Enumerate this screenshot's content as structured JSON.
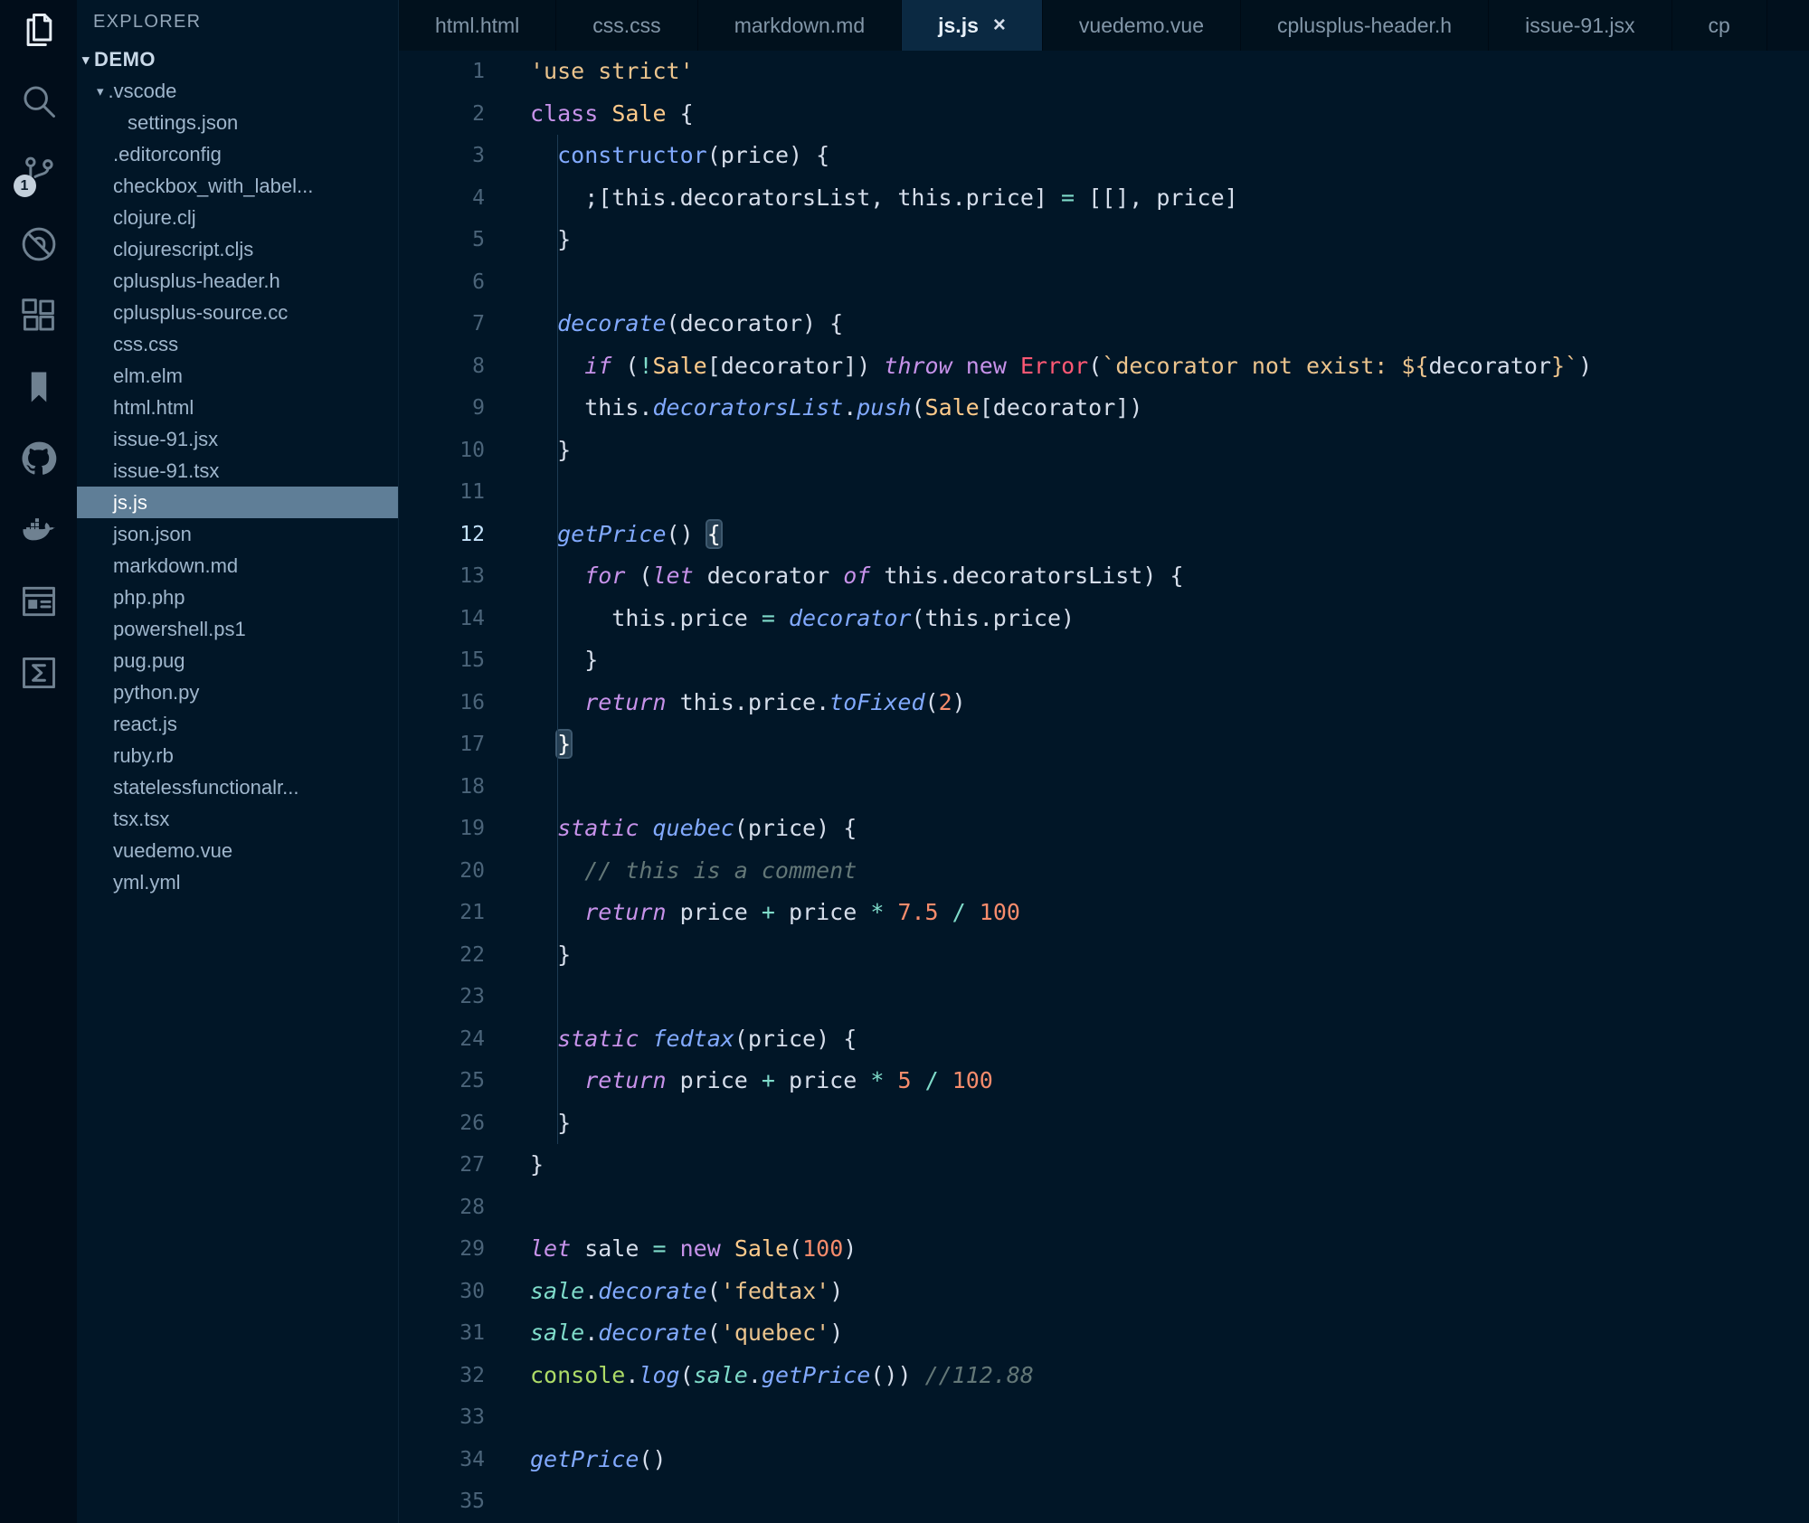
{
  "theme": {
    "bg": "#011627",
    "fg": "#d6deeb",
    "panel": "#010d1a",
    "tabbar": "#01101d",
    "tab_active_bg": "#0b2942",
    "kw": "#c792ea",
    "fn": "#82aaff",
    "str": "#ecc48d",
    "num": "#f78c6c",
    "cmt": "#637777",
    "cls": "#ffcb8b",
    "op": "#7fdbca",
    "err": "#ff5874",
    "grn": "#addb67",
    "vr": "#7fdbca",
    "sel": "#5f7e97",
    "ln": "#4b6479",
    "ln_active": "#c5e4fd"
  },
  "activity_bar": {
    "icons": [
      {
        "name": "files-icon",
        "active": true
      },
      {
        "name": "search-icon"
      },
      {
        "name": "source-control-icon",
        "badge": "1"
      },
      {
        "name": "debug-disabled-icon"
      },
      {
        "name": "extensions-icon"
      },
      {
        "name": "bookmarks-icon"
      },
      {
        "name": "github-icon"
      },
      {
        "name": "docker-icon"
      },
      {
        "name": "browser-preview-icon"
      },
      {
        "name": "terminal-icon"
      }
    ]
  },
  "sidebar": {
    "title": "EXPLORER",
    "items": [
      {
        "label": "DEMO",
        "type": "folder",
        "indent": 6,
        "arrow": true,
        "bold": true
      },
      {
        "label": ".vscode",
        "type": "folder",
        "indent": 22,
        "arrow": true
      },
      {
        "label": "settings.json",
        "type": "file",
        "indent": 56
      },
      {
        "label": ".editorconfig",
        "type": "file",
        "indent": 40
      },
      {
        "label": "checkbox_with_label...",
        "type": "file",
        "indent": 40
      },
      {
        "label": "clojure.clj",
        "type": "file",
        "indent": 40
      },
      {
        "label": "clojurescript.cljs",
        "type": "file",
        "indent": 40
      },
      {
        "label": "cplusplus-header.h",
        "type": "file",
        "indent": 40
      },
      {
        "label": "cplusplus-source.cc",
        "type": "file",
        "indent": 40
      },
      {
        "label": "css.css",
        "type": "file",
        "indent": 40
      },
      {
        "label": "elm.elm",
        "type": "file",
        "indent": 40
      },
      {
        "label": "html.html",
        "type": "file",
        "indent": 40
      },
      {
        "label": "issue-91.jsx",
        "type": "file",
        "indent": 40
      },
      {
        "label": "issue-91.tsx",
        "type": "file",
        "indent": 40
      },
      {
        "label": "js.js",
        "type": "file",
        "indent": 40,
        "selected": true
      },
      {
        "label": "json.json",
        "type": "file",
        "indent": 40
      },
      {
        "label": "markdown.md",
        "type": "file",
        "indent": 40
      },
      {
        "label": "php.php",
        "type": "file",
        "indent": 40
      },
      {
        "label": "powershell.ps1",
        "type": "file",
        "indent": 40
      },
      {
        "label": "pug.pug",
        "type": "file",
        "indent": 40
      },
      {
        "label": "python.py",
        "type": "file",
        "indent": 40
      },
      {
        "label": "react.js",
        "type": "file",
        "indent": 40
      },
      {
        "label": "ruby.rb",
        "type": "file",
        "indent": 40
      },
      {
        "label": "statelessfunctionalr...",
        "type": "file",
        "indent": 40
      },
      {
        "label": "tsx.tsx",
        "type": "file",
        "indent": 40
      },
      {
        "label": "vuedemo.vue",
        "type": "file",
        "indent": 40
      },
      {
        "label": "yml.yml",
        "type": "file",
        "indent": 40
      }
    ]
  },
  "tabs": [
    {
      "label": "html.html"
    },
    {
      "label": "css.css"
    },
    {
      "label": "markdown.md"
    },
    {
      "label": "js.js",
      "active": true,
      "close": "×"
    },
    {
      "label": "vuedemo.vue"
    },
    {
      "label": "cplusplus-header.h"
    },
    {
      "label": "issue-91.jsx"
    },
    {
      "label": "cp",
      "truncated": true
    }
  ],
  "editor": {
    "language": "javascript",
    "current_line": 12,
    "lines": [
      {
        "n": 1,
        "t": [
          [
            "str",
            "'use strict'"
          ]
        ]
      },
      {
        "n": 2,
        "t": [
          [
            "kwu",
            "class "
          ],
          [
            "cls",
            "Sale"
          ],
          [
            "pl",
            " {"
          ]
        ]
      },
      {
        "n": 3,
        "t": [
          [
            "pl",
            "  "
          ],
          [
            "fnu",
            "constructor"
          ],
          [
            "pl",
            "(price) {"
          ]
        ]
      },
      {
        "n": 4,
        "t": [
          [
            "pl",
            "    ;[this.decoratorsList, this.price] "
          ],
          [
            "op",
            "="
          ],
          [
            "pl",
            " [[], price]"
          ]
        ]
      },
      {
        "n": 5,
        "t": [
          [
            "pl",
            "  }"
          ]
        ]
      },
      {
        "n": 6,
        "t": []
      },
      {
        "n": 7,
        "t": [
          [
            "pl",
            "  "
          ],
          [
            "fn",
            "decorate"
          ],
          [
            "pl",
            "(decorator) {"
          ]
        ]
      },
      {
        "n": 8,
        "t": [
          [
            "pl",
            "    "
          ],
          [
            "kw",
            "if"
          ],
          [
            "pl",
            " ("
          ],
          [
            "op",
            "!"
          ],
          [
            "cls",
            "Sale"
          ],
          [
            "pl",
            "[decorator]) "
          ],
          [
            "kw",
            "throw"
          ],
          [
            "pl",
            " "
          ],
          [
            "kwu",
            "new"
          ],
          [
            "pl",
            " "
          ],
          [
            "err",
            "Error"
          ],
          [
            "pl",
            "("
          ],
          [
            "str",
            "`decorator not exist: ${"
          ],
          [
            "pl",
            "decorator"
          ],
          [
            "str",
            "}`"
          ],
          [
            "pl",
            ")"
          ]
        ]
      },
      {
        "n": 9,
        "t": [
          [
            "pl",
            "    this."
          ],
          [
            "fn",
            "decoratorsList"
          ],
          [
            "pl",
            "."
          ],
          [
            "fn",
            "push"
          ],
          [
            "pl",
            "("
          ],
          [
            "cls",
            "Sale"
          ],
          [
            "pl",
            "[decorator])"
          ]
        ]
      },
      {
        "n": 10,
        "t": [
          [
            "pl",
            "  }"
          ]
        ]
      },
      {
        "n": 11,
        "t": []
      },
      {
        "n": 12,
        "t": [
          [
            "pl",
            "  "
          ],
          [
            "fn",
            "getPrice"
          ],
          [
            "pl",
            "() "
          ],
          [
            "hl",
            "{"
          ]
        ]
      },
      {
        "n": 13,
        "t": [
          [
            "pl",
            "    "
          ],
          [
            "kw",
            "for"
          ],
          [
            "pl",
            " ("
          ],
          [
            "kw",
            "let"
          ],
          [
            "pl",
            " decorator "
          ],
          [
            "kw",
            "of"
          ],
          [
            "pl",
            " this.decoratorsList) {"
          ]
        ]
      },
      {
        "n": 14,
        "t": [
          [
            "pl",
            "      this.price "
          ],
          [
            "op",
            "="
          ],
          [
            "pl",
            " "
          ],
          [
            "fn",
            "decorator"
          ],
          [
            "pl",
            "(this.price)"
          ]
        ]
      },
      {
        "n": 15,
        "t": [
          [
            "pl",
            "    }"
          ]
        ]
      },
      {
        "n": 16,
        "t": [
          [
            "pl",
            "    "
          ],
          [
            "kw",
            "return"
          ],
          [
            "pl",
            " this.price."
          ],
          [
            "fn",
            "toFixed"
          ],
          [
            "pl",
            "("
          ],
          [
            "num",
            "2"
          ],
          [
            "pl",
            ")"
          ]
        ]
      },
      {
        "n": 17,
        "t": [
          [
            "pl",
            "  "
          ],
          [
            "hl",
            "}"
          ]
        ]
      },
      {
        "n": 18,
        "t": []
      },
      {
        "n": 19,
        "t": [
          [
            "pl",
            "  "
          ],
          [
            "kw",
            "static"
          ],
          [
            "pl",
            " "
          ],
          [
            "fn",
            "quebec"
          ],
          [
            "pl",
            "(price) {"
          ]
        ]
      },
      {
        "n": 20,
        "t": [
          [
            "pl",
            "    "
          ],
          [
            "cmt",
            "// this is a comment"
          ]
        ]
      },
      {
        "n": 21,
        "t": [
          [
            "pl",
            "    "
          ],
          [
            "kw",
            "return"
          ],
          [
            "pl",
            " price "
          ],
          [
            "op",
            "+"
          ],
          [
            "pl",
            " price "
          ],
          [
            "op",
            "*"
          ],
          [
            "pl",
            " "
          ],
          [
            "num",
            "7.5"
          ],
          [
            "pl",
            " "
          ],
          [
            "op",
            "/"
          ],
          [
            "pl",
            " "
          ],
          [
            "num",
            "100"
          ]
        ]
      },
      {
        "n": 22,
        "t": [
          [
            "pl",
            "  }"
          ]
        ]
      },
      {
        "n": 23,
        "t": []
      },
      {
        "n": 24,
        "t": [
          [
            "pl",
            "  "
          ],
          [
            "kw",
            "static"
          ],
          [
            "pl",
            " "
          ],
          [
            "fn",
            "fedtax"
          ],
          [
            "pl",
            "(price) {"
          ]
        ]
      },
      {
        "n": 25,
        "t": [
          [
            "pl",
            "    "
          ],
          [
            "kw",
            "return"
          ],
          [
            "pl",
            " price "
          ],
          [
            "op",
            "+"
          ],
          [
            "pl",
            " price "
          ],
          [
            "op",
            "*"
          ],
          [
            "pl",
            " "
          ],
          [
            "num",
            "5"
          ],
          [
            "pl",
            " "
          ],
          [
            "op",
            "/"
          ],
          [
            "pl",
            " "
          ],
          [
            "num",
            "100"
          ]
        ]
      },
      {
        "n": 26,
        "t": [
          [
            "pl",
            "  }"
          ]
        ]
      },
      {
        "n": 27,
        "t": [
          [
            "pl",
            "}"
          ]
        ]
      },
      {
        "n": 28,
        "t": []
      },
      {
        "n": 29,
        "t": [
          [
            "kw",
            "let"
          ],
          [
            "pl",
            " sale "
          ],
          [
            "op",
            "="
          ],
          [
            "pl",
            " "
          ],
          [
            "kwu",
            "new"
          ],
          [
            "pl",
            " "
          ],
          [
            "cls",
            "Sale"
          ],
          [
            "pl",
            "("
          ],
          [
            "num",
            "100"
          ],
          [
            "pl",
            ")"
          ]
        ]
      },
      {
        "n": 30,
        "t": [
          [
            "vr",
            "sale"
          ],
          [
            "pl",
            "."
          ],
          [
            "fn",
            "decorate"
          ],
          [
            "pl",
            "("
          ],
          [
            "str",
            "'fedtax'"
          ],
          [
            "pl",
            ")"
          ]
        ]
      },
      {
        "n": 31,
        "t": [
          [
            "vr",
            "sale"
          ],
          [
            "pl",
            "."
          ],
          [
            "fn",
            "decorate"
          ],
          [
            "pl",
            "("
          ],
          [
            "str",
            "'quebec'"
          ],
          [
            "pl",
            ")"
          ]
        ]
      },
      {
        "n": 32,
        "t": [
          [
            "grn",
            "console"
          ],
          [
            "pl",
            "."
          ],
          [
            "fn",
            "log"
          ],
          [
            "pl",
            "("
          ],
          [
            "vr",
            "sale"
          ],
          [
            "pl",
            "."
          ],
          [
            "fn",
            "getPrice"
          ],
          [
            "pl",
            "()) "
          ],
          [
            "cmt",
            "//112.88"
          ]
        ]
      },
      {
        "n": 33,
        "t": []
      },
      {
        "n": 34,
        "t": [
          [
            "fn",
            "getPrice"
          ],
          [
            "pl",
            "()"
          ]
        ]
      },
      {
        "n": 35,
        "t": []
      }
    ]
  }
}
